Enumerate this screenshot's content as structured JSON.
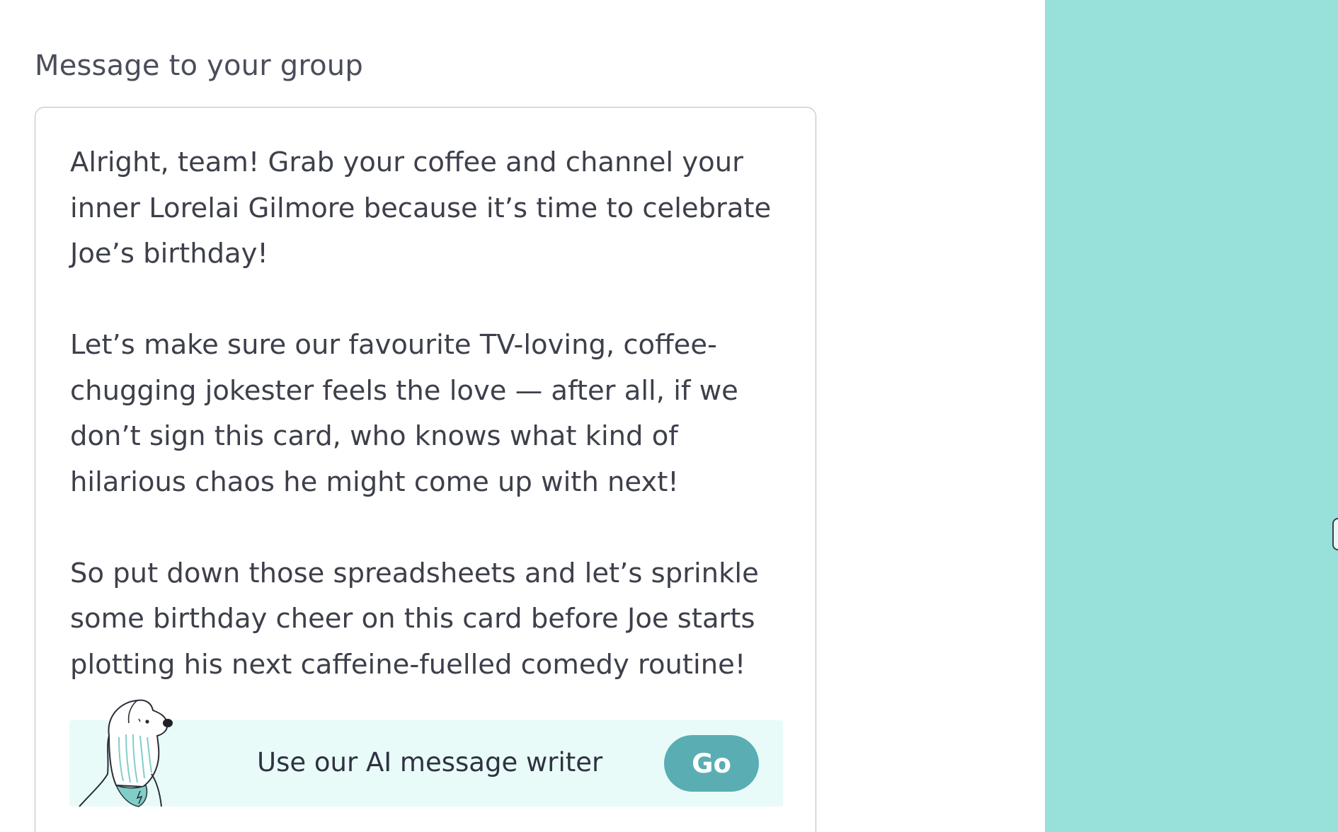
{
  "section": {
    "label": "Message to your group"
  },
  "message": {
    "text": "Alright, team! Grab your coffee and channel your\ninner Lorelai Gilmore because it’s time to celebrate\nJoe’s birthday!\n\nLet’s make sure our favourite TV-loving, coffee-\nchugging jokester feels the love — after all, if we\ndon’t sign this card, who knows what kind of\nhilarious chaos he might come up with next!\n\nSo put down those spreadsheets and let’s sprinkle\nsome birthday cheer on this card before Joe starts\nplotting his next caffeine-fuelled comedy routine!"
  },
  "ai_writer": {
    "label": "Use our AI message writer",
    "button_label": "Go",
    "mascot_icon": "dog-mascot-icon"
  },
  "colors": {
    "side_panel": "#98e0da",
    "ai_bar_background": "#e8fbf9",
    "go_button": "#5aadb3",
    "text": "#3d404b"
  }
}
